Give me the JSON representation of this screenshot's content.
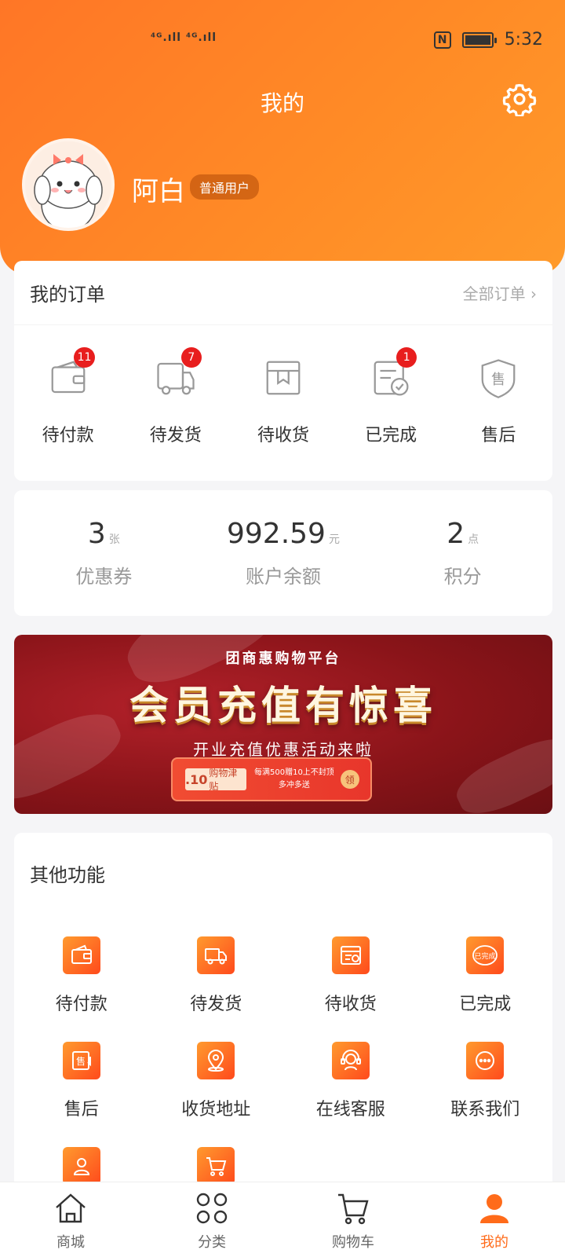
{
  "status_bar": {
    "signal": "⁴ᴳ.ıll ⁴ᴳ.ıll",
    "nfc": "N",
    "time": "5:32"
  },
  "header": {
    "title": "我的"
  },
  "user": {
    "name": "阿白",
    "badge": "普通用户"
  },
  "orders": {
    "title": "我的订单",
    "all_link": "全部订单 ›",
    "items": [
      {
        "label": "待付款",
        "badge": "11",
        "icon": "wallet-icon"
      },
      {
        "label": "待发货",
        "badge": "7",
        "icon": "truck-icon"
      },
      {
        "label": "待收货",
        "badge": "",
        "icon": "package-icon"
      },
      {
        "label": "已完成",
        "badge": "1",
        "icon": "document-check-icon"
      },
      {
        "label": "售后",
        "badge": "",
        "icon": "shield-icon"
      }
    ]
  },
  "stats": [
    {
      "value": "3",
      "unit": "张",
      "label": "优惠券"
    },
    {
      "value": "992.59",
      "unit": "元",
      "label": "账户余额"
    },
    {
      "value": "2",
      "unit": "点",
      "label": "积分"
    }
  ],
  "banner": {
    "top": "团商惠购物平台",
    "main": "会员充值有惊喜",
    "sub": "开业充值优惠活动来啦",
    "coupon_amount": ".10",
    "coupon_name": "购物津贴",
    "coupon_desc1": "每满500赠10上不封顶",
    "coupon_desc2": "多冲多送",
    "coupon_btn": "领"
  },
  "other": {
    "title": "其他功能",
    "items": [
      {
        "label": "待付款",
        "icon": "wallet-icon"
      },
      {
        "label": "待发货",
        "icon": "truck-icon"
      },
      {
        "label": "待收货",
        "icon": "calendar-clock-icon"
      },
      {
        "label": "已完成",
        "icon": "completed-stamp-icon"
      },
      {
        "label": "售后",
        "icon": "after-sale-icon"
      },
      {
        "label": "收货地址",
        "icon": "location-pin-icon"
      },
      {
        "label": "在线客服",
        "icon": "headset-icon"
      },
      {
        "label": "联系我们",
        "icon": "chat-bubble-icon"
      },
      {
        "label": "",
        "icon": "user-profile-icon"
      },
      {
        "label": "",
        "icon": "cart-icon"
      }
    ]
  },
  "tabs": [
    {
      "label": "商城",
      "icon": "home-icon"
    },
    {
      "label": "分类",
      "icon": "category-icon"
    },
    {
      "label": "购物车",
      "icon": "cart-icon"
    },
    {
      "label": "我的",
      "icon": "user-icon",
      "active": true
    }
  ],
  "colors": {
    "accent": "#ff7a26",
    "badge": "#e81e1e",
    "active_tab": "#ff6b1a"
  }
}
